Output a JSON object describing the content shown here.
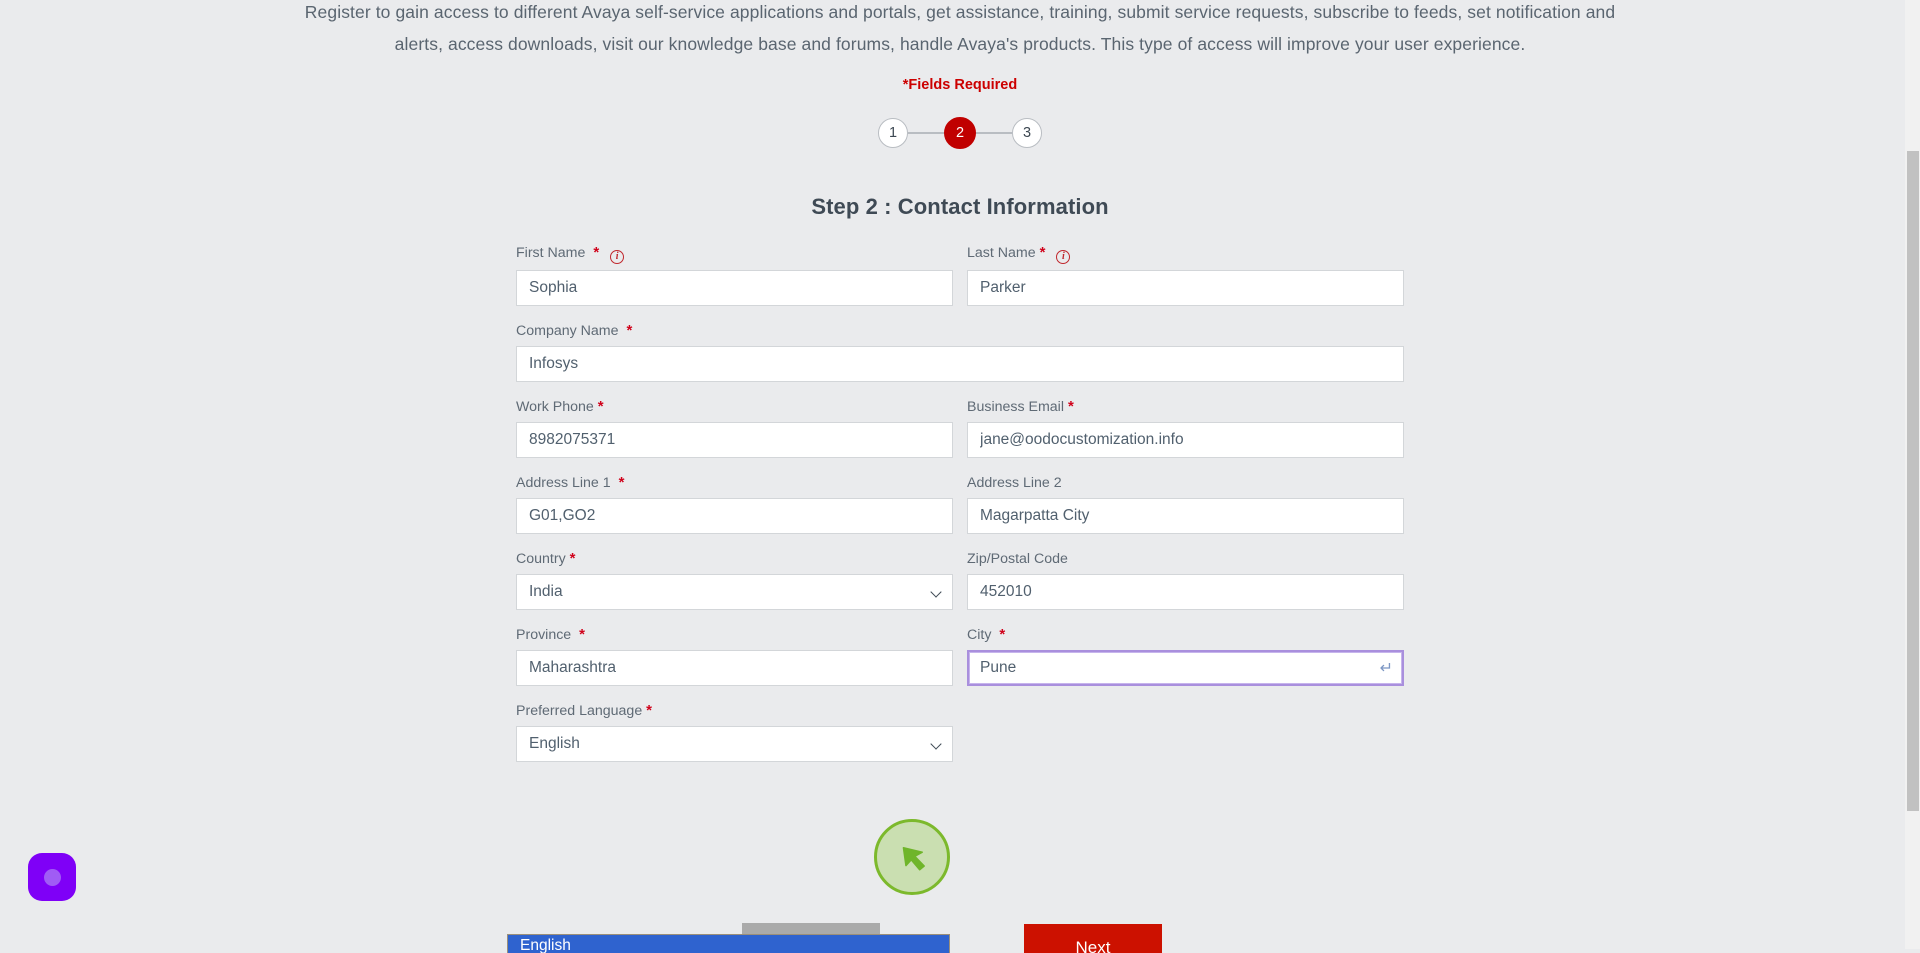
{
  "intro": {
    "line1": "Register to gain access to different Avaya self-service applications and portals, get assistance, training, submit service requests, subscribe to feeds, set notification and",
    "line2": "alerts, access downloads, visit our knowledge base and forums, handle Avaya's products. This type of access will improve your user experience.",
    "fields_required": "*Fields Required"
  },
  "stepper": {
    "steps": [
      {
        "number": "1",
        "state": "inactive"
      },
      {
        "number": "2",
        "state": "active"
      },
      {
        "number": "3",
        "state": "inactive"
      }
    ],
    "active_color": "#c00000"
  },
  "form": {
    "title": "Step 2 : Contact Information",
    "required_marker": "*",
    "fields": {
      "first_name": {
        "label": "First Name",
        "value": "Sophia",
        "placeholder": "First Name",
        "required": "*",
        "info": "i"
      },
      "last_name": {
        "label": "Last Name",
        "value": "Parker",
        "placeholder": "Last Name",
        "required": "*",
        "info": "i"
      },
      "company_name": {
        "label": "Company Name",
        "value": "Infosys",
        "placeholder": "Company Name",
        "required": "*"
      },
      "work_phone": {
        "label": "Work Phone",
        "value": "8982075371",
        "placeholder": "Work Phone",
        "required": "*"
      },
      "business_email": {
        "label": "Business Email",
        "value": "jane@oodocustomization.info",
        "placeholder": "Business Email",
        "required": "*"
      },
      "address_line_1": {
        "label": "Address Line 1",
        "value": "G01,GO2",
        "placeholder": "Address Line 1",
        "required": "*"
      },
      "address_line_2": {
        "label": "Address Line 2",
        "value": "Magarpatta City",
        "placeholder": "Address Line 2",
        "required": ""
      },
      "country": {
        "label": "Country",
        "value": "India",
        "required": "*"
      },
      "zip": {
        "label": "Zip/Postal Code",
        "value": "452010",
        "placeholder": "Zip/Postal Code",
        "required": ""
      },
      "province": {
        "label": "Province",
        "value": "Maharashtra",
        "placeholder": "Province",
        "required": "*"
      },
      "city": {
        "label": "City",
        "value": "Pune",
        "placeholder": "City",
        "required": "*",
        "focused": true,
        "enter_glyph": "↵"
      },
      "preferred_language": {
        "label": "Preferred Language",
        "value": "English",
        "required": "*"
      }
    },
    "next_label": "Next"
  },
  "dropdown_open": {
    "highlighted_option": "English",
    "highlight_color": "#2f63cf"
  },
  "widget": {
    "name": "chat-widget-launcher",
    "color": "#7f00f7"
  },
  "cursor": {
    "color": "#7cb92c"
  }
}
